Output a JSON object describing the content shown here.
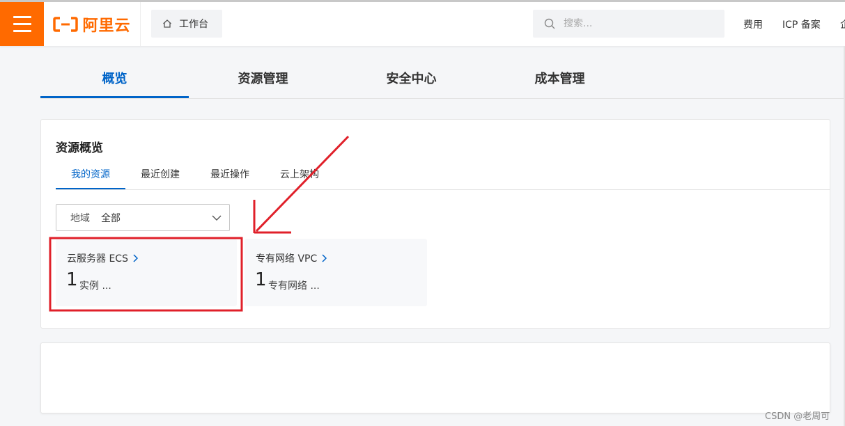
{
  "header": {
    "logo_text": "阿里云",
    "home_label": "工作台",
    "search_placeholder": "搜索...",
    "links": [
      "费用",
      "ICP 备案",
      "企"
    ]
  },
  "main_tabs": [
    {
      "label": "概览",
      "active": true
    },
    {
      "label": "资源管理",
      "active": false
    },
    {
      "label": "安全中心",
      "active": false
    },
    {
      "label": "成本管理",
      "active": false
    }
  ],
  "overview": {
    "title": "资源概览",
    "subtabs": [
      {
        "label": "我的资源",
        "active": true
      },
      {
        "label": "最近创建",
        "active": false
      },
      {
        "label": "最近操作",
        "active": false
      },
      {
        "label": "云上架构",
        "active": false
      }
    ],
    "region": {
      "label": "地域",
      "value": "全部"
    },
    "resources": [
      {
        "name": "云服务器 ECS",
        "count": "1",
        "unit": "实例 ..."
      },
      {
        "name": "专有网络 VPC",
        "count": "1",
        "unit": "专有网络 ..."
      }
    ]
  },
  "watermark": "CSDN @老周可",
  "colors": {
    "brand": "#ff6a00",
    "accent": "#0064c8",
    "annotation": "#e0202a"
  }
}
